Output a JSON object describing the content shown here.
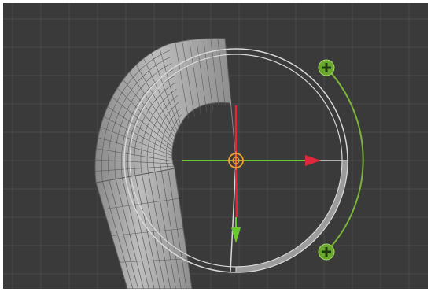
{
  "viewport": {
    "label": "3D viewport",
    "colors": {
      "background": "#3a3a3a",
      "grid_line": "#4a4a4a",
      "mesh_fill": "#a8a8a8",
      "mesh_line": "#5c5c5c",
      "ring": "#d8d8d8",
      "ring_segment": "#9c9c9c",
      "axis_red": "#e0283c",
      "axis_green": "#6cc832",
      "arc_green": "#7ab43a",
      "handle_green": "#6aa82c",
      "pivot_orange": "#f0a030"
    }
  },
  "gizmo": {
    "handles": [
      {
        "name": "top-plus-handle",
        "icon": "plus-icon"
      },
      {
        "name": "bottom-plus-handle",
        "icon": "plus-icon"
      }
    ],
    "pivot_icon": "pivot-target-icon",
    "axes": [
      "x-axis-arrow-red",
      "y-axis-arrow-green"
    ]
  },
  "mesh": {
    "name": "bent-tube-mesh"
  }
}
